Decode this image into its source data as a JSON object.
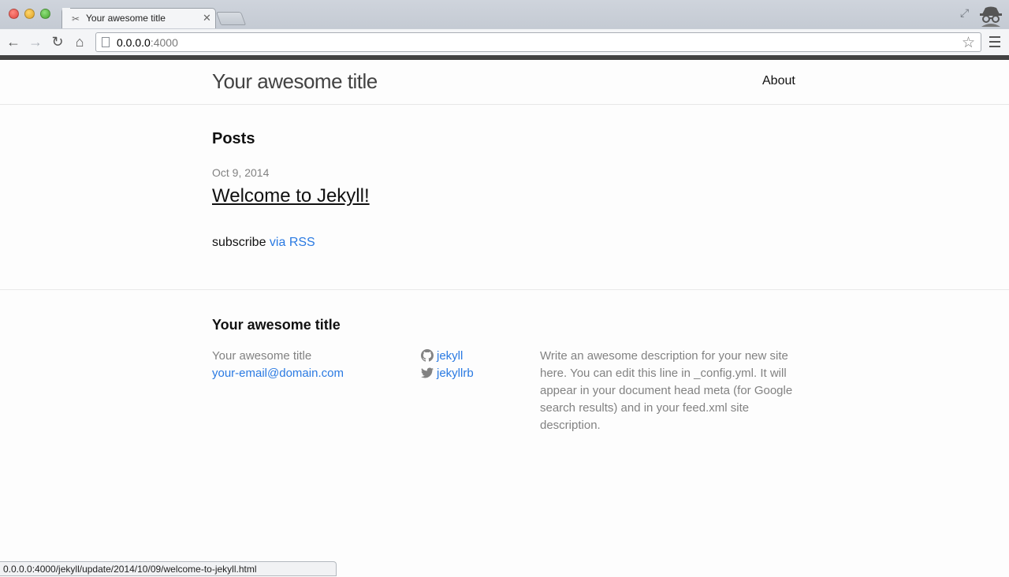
{
  "browser": {
    "tab_title": "Your awesome title",
    "url_host": "0.0.0.0",
    "url_port": ":4000",
    "status_url": "0.0.0.0:4000/jekyll/update/2014/10/09/welcome-to-jekyll.html"
  },
  "header": {
    "site_title": "Your awesome title",
    "nav": [
      {
        "label": "About"
      }
    ]
  },
  "main": {
    "posts_heading": "Posts",
    "posts": [
      {
        "date": "Oct 9, 2014",
        "title": "Welcome to Jekyll!"
      }
    ],
    "subscribe_text": "subscribe ",
    "rss_link": "via RSS"
  },
  "footer": {
    "heading": "Your awesome title",
    "name": "Your awesome title",
    "email": "your-email@domain.com",
    "social": [
      {
        "icon": "github-icon",
        "label": "jekyll"
      },
      {
        "icon": "twitter-icon",
        "label": "jekyllrb"
      }
    ],
    "description": "Write an awesome description for your new site here. You can edit this line in _config.yml. It will appear in your document head meta (for Google search results) and in your feed.xml site description."
  },
  "colors": {
    "link": "#2a7ae2",
    "muted": "#828282",
    "text": "#111111"
  }
}
